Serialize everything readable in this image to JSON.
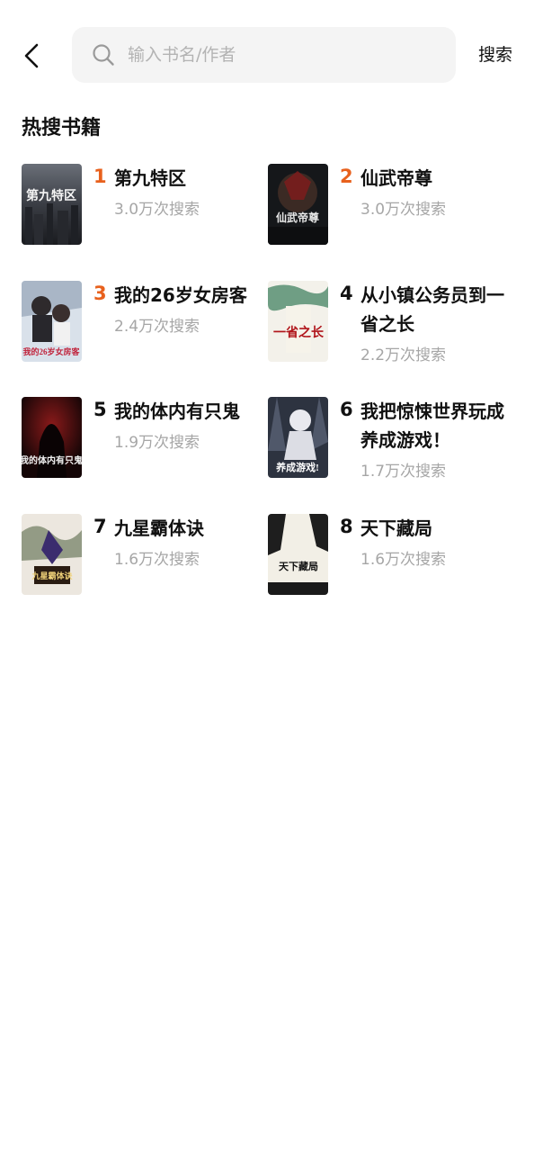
{
  "header": {
    "back_icon": "chevron-left-icon",
    "search_placeholder": "输入书名/作者",
    "search_value": "",
    "search_button": "搜索"
  },
  "section": {
    "title": "热搜书籍"
  },
  "colors": {
    "rank_hot": "#e8611d",
    "rank_normal": "#111111",
    "count_text": "#a6a6a6",
    "search_bg": "#f4f4f4"
  },
  "books": [
    {
      "rank": "1",
      "title": "第九特区",
      "count": "3.0万次搜索",
      "cover_text": "第九特区"
    },
    {
      "rank": "2",
      "title": "仙武帝尊",
      "count": "3.0万次搜索",
      "cover_text": "仙武帝尊"
    },
    {
      "rank": "3",
      "title": "我的26岁女房客",
      "count": "2.4万次搜索",
      "cover_text": "我的26岁女房客"
    },
    {
      "rank": "4",
      "title": "从小镇公务员到一省之长",
      "count": "2.2万次搜索",
      "cover_text": "一省之长"
    },
    {
      "rank": "5",
      "title": "我的体内有只鬼",
      "count": "1.9万次搜索",
      "cover_text": "我的体内有只鬼"
    },
    {
      "rank": "6",
      "title": "我把惊悚世界玩成养成游戏！",
      "count": "1.7万次搜索",
      "cover_text": "养成游戏!"
    },
    {
      "rank": "7",
      "title": "九星霸体诀",
      "count": "1.6万次搜索",
      "cover_text": "九星霸体诀"
    },
    {
      "rank": "8",
      "title": "天下藏局",
      "count": "1.6万次搜索",
      "cover_text": "天下藏局"
    }
  ]
}
